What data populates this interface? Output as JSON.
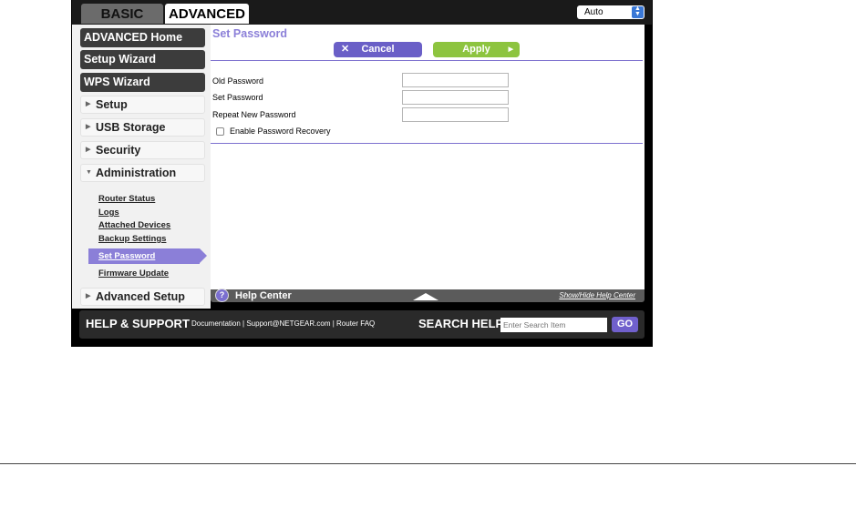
{
  "tabs": {
    "basic": "BASIC",
    "advanced": "ADVANCED"
  },
  "language_select": {
    "value": "Auto"
  },
  "sidebar": {
    "primary": [
      "ADVANCED Home",
      "Setup Wizard",
      "WPS Wizard"
    ],
    "sections": {
      "setup": "Setup",
      "usb_storage": "USB Storage",
      "security": "Security",
      "administration": "Administration",
      "advanced_setup": "Advanced Setup"
    },
    "admin_items": [
      "Router Status",
      "Logs",
      "Attached Devices",
      "Backup Settings",
      "Set Password",
      "Firmware Update"
    ]
  },
  "main": {
    "title": "Set Password",
    "cancel_label": "Cancel",
    "apply_label": "Apply",
    "fields": {
      "old_password": "Old Password",
      "set_password": "Set Password",
      "repeat_password": "Repeat New Password"
    },
    "recovery_label": "Enable Password Recovery"
  },
  "help": {
    "label": "Help Center",
    "toggle": "Show/Hide Help Center"
  },
  "footer": {
    "title": "HELP & SUPPORT",
    "links": [
      "Documentation",
      "Support@NETGEAR.com",
      "Router FAQ"
    ],
    "search_title": "SEARCH HELP",
    "search_placeholder": "Enter Search Item",
    "go_label": "GO"
  },
  "colors": {
    "accent": "#8b7fd8",
    "apply": "#8dc43f",
    "cancel": "#6a5fc7"
  }
}
